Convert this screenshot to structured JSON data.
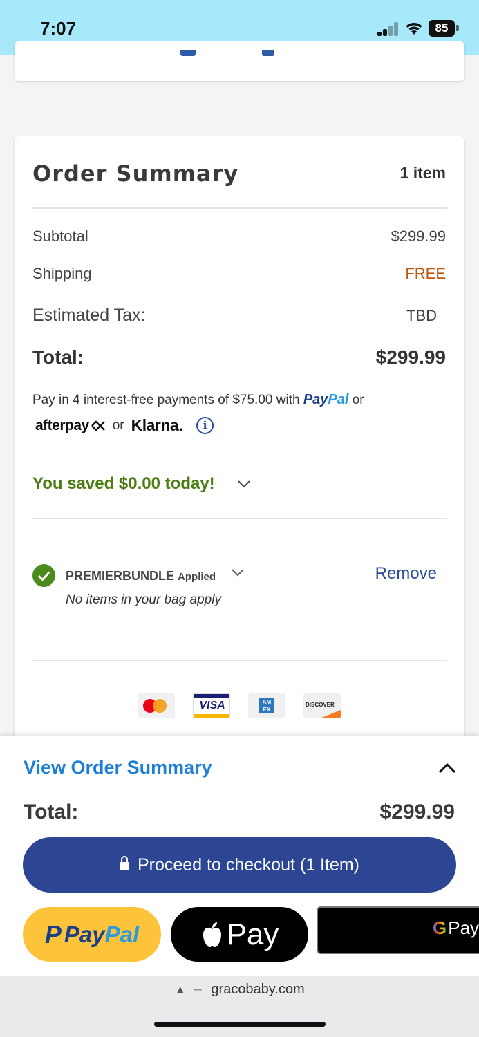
{
  "status_bar": {
    "time": "7:07",
    "battery": "85"
  },
  "order_summary": {
    "title": "Order Summary",
    "item_count": "1 item",
    "subtotal_label": "Subtotal",
    "subtotal_value": "$299.99",
    "shipping_label": "Shipping",
    "shipping_value": "FREE",
    "tax_label": "Estimated Tax:",
    "tax_value": "TBD",
    "total_label": "Total:",
    "total_value": "$299.99",
    "installment_text": "Pay in 4 interest-free payments of $75.00 with",
    "installment_paypal_a": "Pay",
    "installment_paypal_b": "Pal",
    "installment_or": "or",
    "afterpay": "afterpay",
    "klarna_or": "or",
    "klarna": "Klarna.",
    "info": "i",
    "savings_text": "You saved $0.00 today!",
    "promo_code": "PREMIERBUNDLE",
    "promo_status": "Applied",
    "promo_note": "No items in your bag apply",
    "remove_label": "Remove",
    "card_brands": [
      "mastercard",
      "visa",
      "amex",
      "discover"
    ],
    "visa_text": "VISA",
    "amex_text": "AM EX",
    "discover_text": "DISCOVER"
  },
  "sticky_footer": {
    "view_summary_label": "View Order Summary",
    "total_label": "Total:",
    "total_value": "$299.99",
    "checkout_label": "Proceed to checkout (1 Item)",
    "paypal_a": "Pay",
    "paypal_b": "Pal",
    "paypal_mark": "P",
    "apple_pay_label": "Pay",
    "gpay_g": "G",
    "gpay_label": "Pay"
  },
  "url_bar": {
    "domain": "gracobaby.com",
    "warning_icon": "▲",
    "dash": "–"
  },
  "colors": {
    "status_bar_bg": "#a8e8fb",
    "free_text": "#c0560a",
    "savings_green": "#4a7d0f",
    "link_blue": "#2b4a9b",
    "view_summary_blue": "#1e7fd6",
    "checkout_bg": "#2c4693",
    "paypal_yellow": "#fdc33a"
  }
}
